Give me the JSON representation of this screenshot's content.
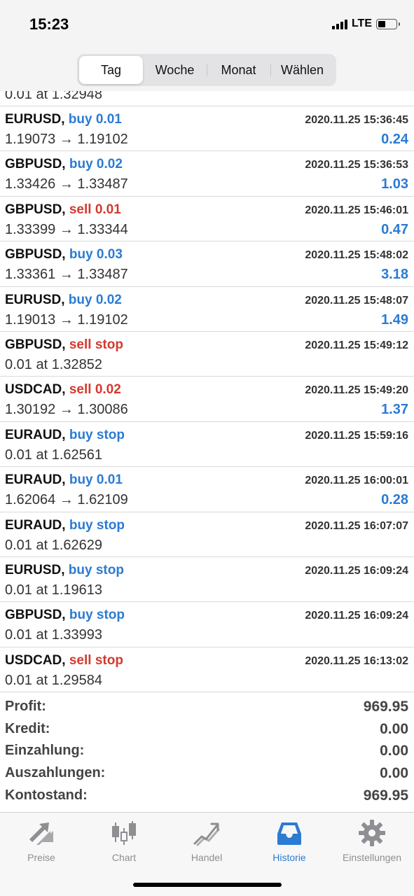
{
  "status_bar": {
    "time": "15:23",
    "network": "LTE",
    "battery_level": 0.4
  },
  "period_tabs": [
    {
      "label": "Tag",
      "active": true
    },
    {
      "label": "Woche",
      "active": false
    },
    {
      "label": "Monat",
      "active": false
    },
    {
      "label": "Wählen",
      "active": false
    }
  ],
  "partial_row": {
    "price": "0.01 at 1.32948"
  },
  "trades": [
    {
      "symbol": "EURUSD,",
      "action": "buy 0.01",
      "side": "buy",
      "date": "2020.11.25 15:36:45",
      "price": "1.19073 → 1.19102",
      "profit": "0.24"
    },
    {
      "symbol": "GBPUSD,",
      "action": "buy 0.02",
      "side": "buy",
      "date": "2020.11.25 15:36:53",
      "price": "1.33426 → 1.33487",
      "profit": "1.03"
    },
    {
      "symbol": "GBPUSD,",
      "action": "sell 0.01",
      "side": "sell",
      "date": "2020.11.25 15:46:01",
      "price": "1.33399 → 1.33344",
      "profit": "0.47"
    },
    {
      "symbol": "GBPUSD,",
      "action": "buy 0.03",
      "side": "buy",
      "date": "2020.11.25 15:48:02",
      "price": "1.33361 → 1.33487",
      "profit": "3.18"
    },
    {
      "symbol": "EURUSD,",
      "action": "buy 0.02",
      "side": "buy",
      "date": "2020.11.25 15:48:07",
      "price": "1.19013 → 1.19102",
      "profit": "1.49"
    },
    {
      "symbol": "GBPUSD,",
      "action": "sell stop",
      "side": "sell",
      "date": "2020.11.25 15:49:12",
      "price": "0.01 at 1.32852",
      "profit": ""
    },
    {
      "symbol": "USDCAD,",
      "action": "sell 0.02",
      "side": "sell",
      "date": "2020.11.25 15:49:20",
      "price": "1.30192 → 1.30086",
      "profit": "1.37"
    },
    {
      "symbol": "EURAUD,",
      "action": "buy stop",
      "side": "buy",
      "date": "2020.11.25 15:59:16",
      "price": "0.01 at 1.62561",
      "profit": ""
    },
    {
      "symbol": "EURAUD,",
      "action": "buy 0.01",
      "side": "buy",
      "date": "2020.11.25 16:00:01",
      "price": "1.62064 → 1.62109",
      "profit": "0.28"
    },
    {
      "symbol": "EURAUD,",
      "action": "buy stop",
      "side": "buy",
      "date": "2020.11.25 16:07:07",
      "price": "0.01 at 1.62629",
      "profit": ""
    },
    {
      "symbol": "EURUSD,",
      "action": "buy stop",
      "side": "buy",
      "date": "2020.11.25 16:09:24",
      "price": "0.01 at 1.19613",
      "profit": ""
    },
    {
      "symbol": "GBPUSD,",
      "action": "buy stop",
      "side": "buy",
      "date": "2020.11.25 16:09:24",
      "price": "0.01 at 1.33993",
      "profit": ""
    },
    {
      "symbol": "USDCAD,",
      "action": "sell stop",
      "side": "sell",
      "date": "2020.11.25 16:13:02",
      "price": "0.01 at 1.29584",
      "profit": ""
    }
  ],
  "summary": [
    {
      "label": "Profit:",
      "value": "969.95"
    },
    {
      "label": "Kredit:",
      "value": "0.00"
    },
    {
      "label": "Einzahlung:",
      "value": "0.00"
    },
    {
      "label": "Auszahlungen:",
      "value": "0.00"
    },
    {
      "label": "Kontostand:",
      "value": "969.95"
    }
  ],
  "tabbar": [
    {
      "label": "Preise",
      "icon": "arrows-icon",
      "active": false
    },
    {
      "label": "Chart",
      "icon": "candlestick-icon",
      "active": false
    },
    {
      "label": "Handel",
      "icon": "trend-icon",
      "active": false
    },
    {
      "label": "Historie",
      "icon": "inbox-icon",
      "active": true
    },
    {
      "label": "Einstellungen",
      "icon": "gear-icon",
      "active": false
    }
  ],
  "colors": {
    "buy": "#2b7bd3",
    "sell": "#d23a2e",
    "active_tab": "#2b7bd3",
    "inactive_tab": "#8e8e93"
  }
}
